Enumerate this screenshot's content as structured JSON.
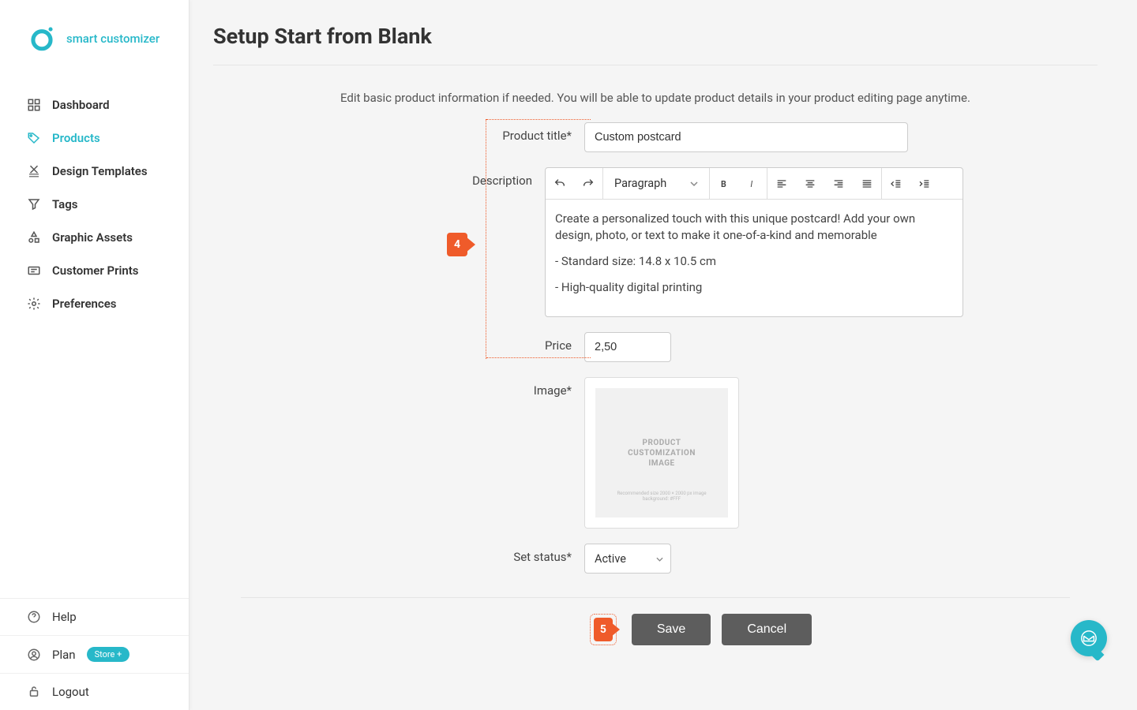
{
  "brand": {
    "name": "smart customizer"
  },
  "sidebar": {
    "items": [
      {
        "label": "Dashboard"
      },
      {
        "label": "Products"
      },
      {
        "label": "Design Templates"
      },
      {
        "label": "Tags"
      },
      {
        "label": "Graphic Assets"
      },
      {
        "label": "Customer Prints"
      },
      {
        "label": "Preferences"
      }
    ],
    "bottom": {
      "help": "Help",
      "plan": "Plan",
      "plan_badge": "Store +",
      "logout": "Logout"
    }
  },
  "page": {
    "title": "Setup Start from Blank",
    "intro": "Edit basic product information if needed. You will be able to update product details in your product editing page anytime."
  },
  "steps": {
    "four": "4",
    "five": "5"
  },
  "form": {
    "product_title_label": "Product title*",
    "product_title_value": "Custom postcard",
    "description_label": "Description",
    "description_para1": "Create a personalized touch with this unique postcard! Add your own design, photo, or text to make it one-of-a-kind and memorable",
    "description_para2": "- Standard size: 14.8 x 10.5 cm",
    "description_para3": "- High-quality digital printing",
    "block_format": "Paragraph",
    "price_label": "Price",
    "price_value": "2,50",
    "image_label": "Image*",
    "image_placeholder_big": "PRODUCT\nCUSTOMIZATION\nIMAGE",
    "image_placeholder_tiny": "Recommended size 2000 × 2000 px image background: #FFF",
    "status_label": "Set status*",
    "status_value": "Active"
  },
  "actions": {
    "save": "Save",
    "cancel": "Cancel"
  }
}
